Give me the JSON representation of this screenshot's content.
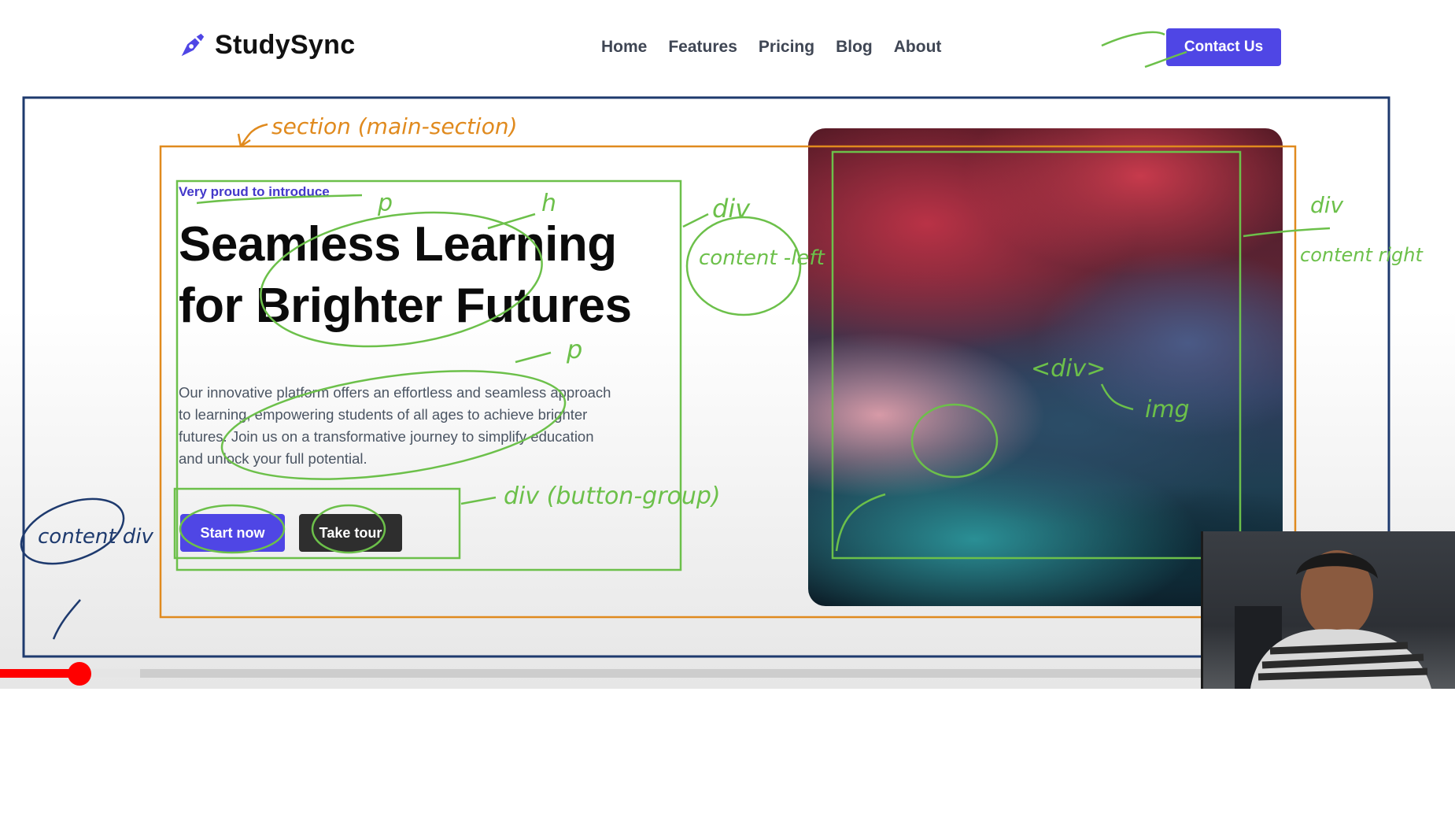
{
  "brand": {
    "name": "StudySync",
    "icon": "pen-nib-icon",
    "accent": "#4f46e5"
  },
  "nav": {
    "items": [
      "Home",
      "Features",
      "Pricing",
      "Blog",
      "About"
    ],
    "cta": "Contact Us"
  },
  "hero": {
    "tagline": "Very proud to introduce",
    "headline_line1": "Seamless Learning",
    "headline_line2": "for Brighter Futures",
    "description": "Our innovative platform offers an effortless and seamless approach to learning, empowering students of all ages to achieve brighter futures. Join us on a transformative journey to simplify education and unlock your full potential.",
    "primary_button": "Start now",
    "secondary_button": "Take tour"
  },
  "video": {
    "progress_fraction": 0.066,
    "buffered_fraction": 0.116,
    "progress_color": "#ff0000"
  },
  "annotations": {
    "section": "section (main-section)",
    "p1": "p",
    "h": "h",
    "div_left": "div",
    "content_left": "content -left",
    "p2": "p",
    "button_group": "div (button-group)",
    "div_right": "div",
    "content_right": "content right",
    "div_img": "<div>",
    "img": "img",
    "content_div": "content div"
  }
}
